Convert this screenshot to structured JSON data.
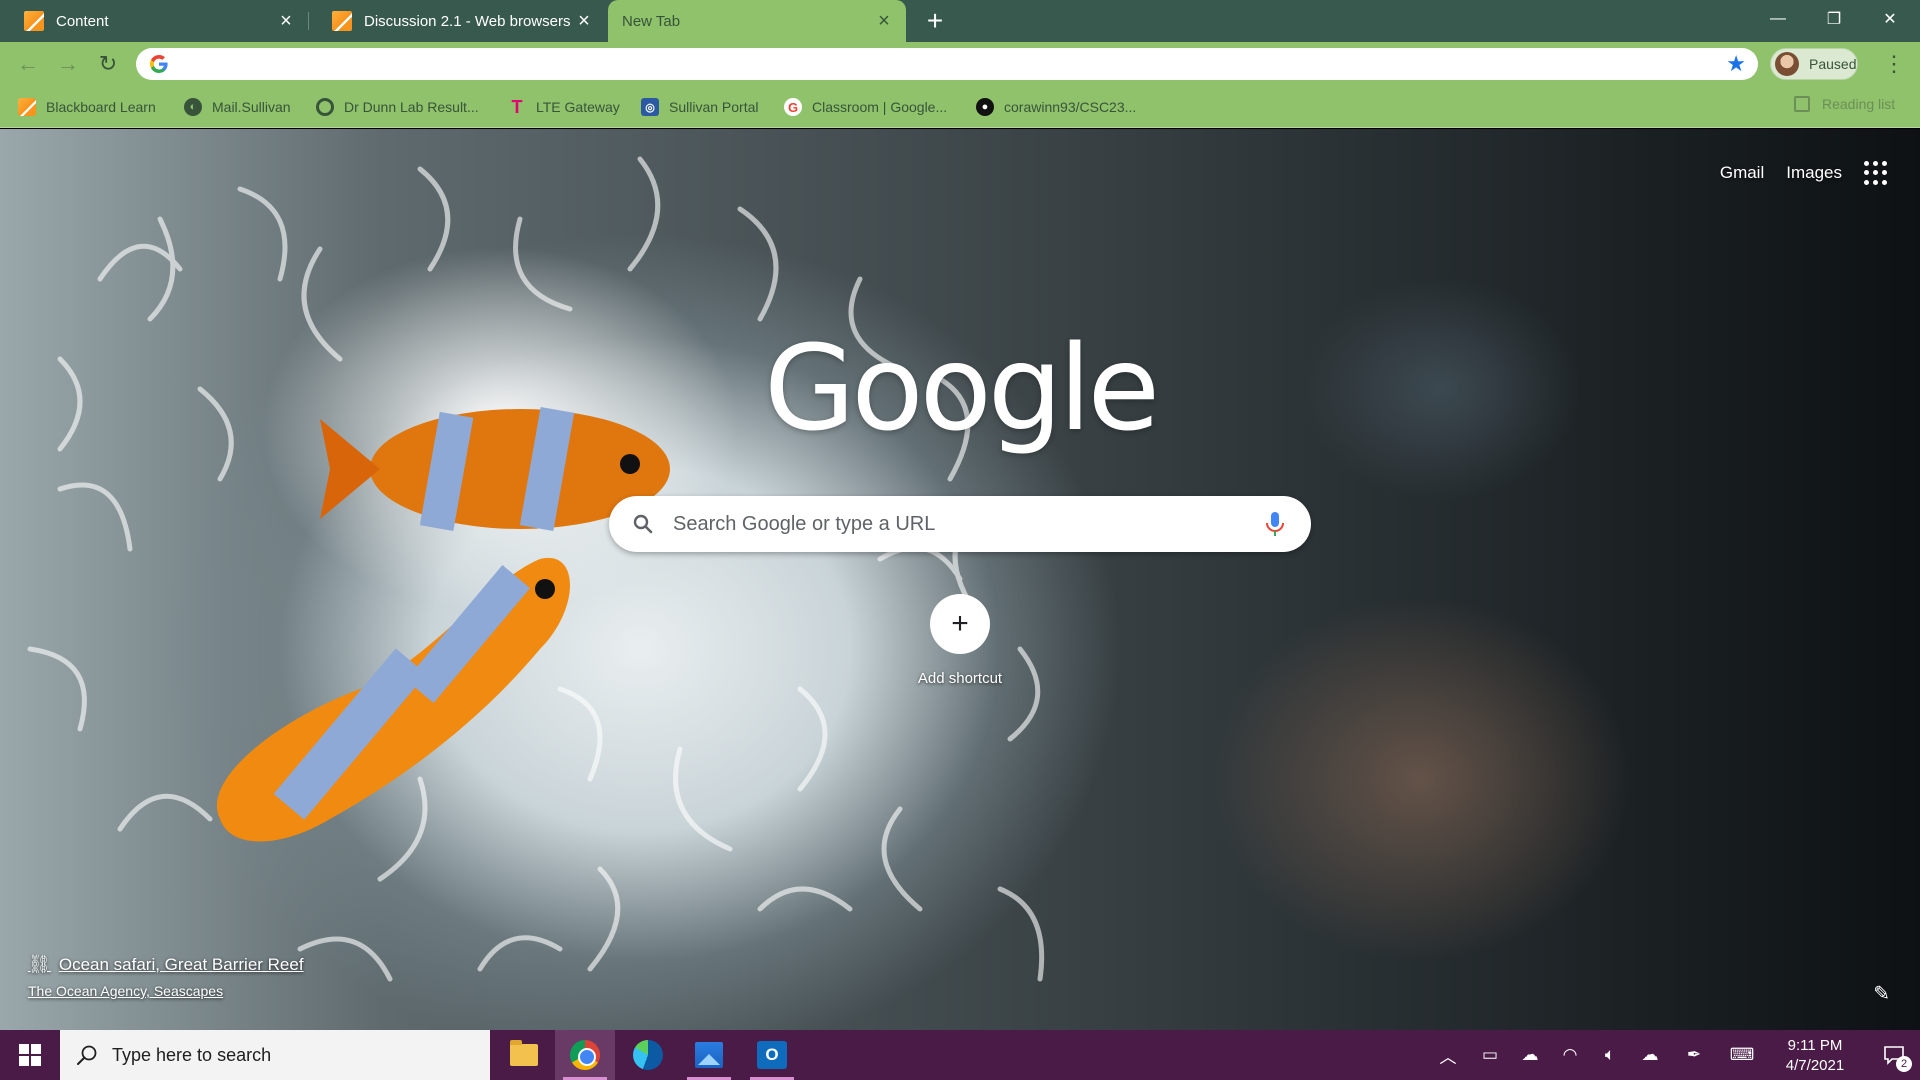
{
  "tabs": [
    {
      "title": "Content",
      "active": false
    },
    {
      "title": "Discussion 2.1 - Web browsers -",
      "active": false
    },
    {
      "title": "New Tab",
      "active": true
    }
  ],
  "window_controls": {
    "minimize": "—",
    "restore": "❐",
    "close": "✕"
  },
  "toolbar": {
    "omnibox_value": "",
    "profile_label": "Paused"
  },
  "bookmarks": [
    {
      "label": "Blackboard Learn",
      "icon": "blackboard-icon"
    },
    {
      "label": "Mail.Sullivan",
      "icon": "globe-icon"
    },
    {
      "label": "Dr Dunn Lab Result...",
      "icon": "ring-icon"
    },
    {
      "label": "LTE Gateway",
      "icon": "tmobile-icon"
    },
    {
      "label": "Sullivan Portal",
      "icon": "portal-icon"
    },
    {
      "label": "Classroom | Google...",
      "icon": "google-icon"
    },
    {
      "label": "corawinn93/CSC23...",
      "icon": "github-icon"
    }
  ],
  "reading_list": "Reading list",
  "ntp": {
    "gmail": "Gmail",
    "images": "Images",
    "logo": "Google",
    "search_placeholder": "Search Google or type a URL",
    "add_shortcut": "Add shortcut",
    "attribution_title": "Ocean safari, Great Barrier Reef",
    "attribution_credit": "The Ocean Agency, Seascapes"
  },
  "taskbar": {
    "search_placeholder": "Type here to search",
    "time": "9:11 PM",
    "date": "4/7/2021",
    "notification_count": "2"
  },
  "colors": {
    "tabstrip": "#385a4e",
    "toolbar": "#8fc26a",
    "taskbar": "#4a1b47",
    "accent_star": "#1a73e8"
  }
}
